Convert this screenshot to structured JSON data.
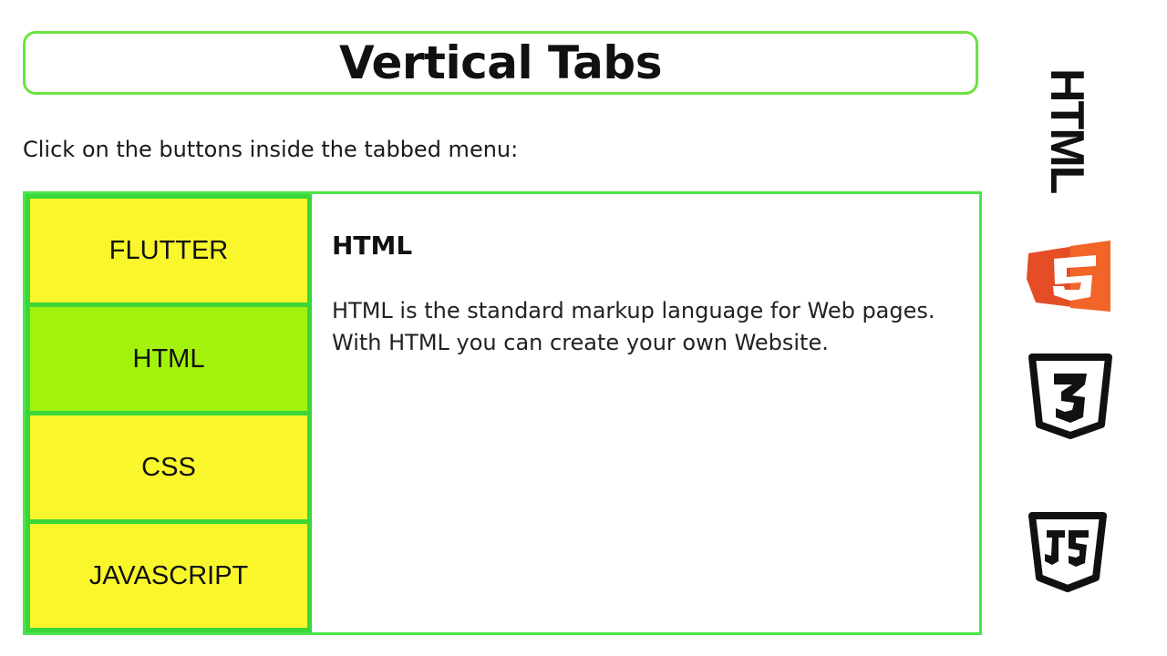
{
  "header": {
    "title": "Vertical Tabs"
  },
  "instruction": "Click on the buttons inside the tabbed menu:",
  "tabs": [
    {
      "label": "FLUTTER",
      "active": false
    },
    {
      "label": "HTML",
      "active": true
    },
    {
      "label": "CSS",
      "active": false
    },
    {
      "label": "JAVASCRIPT",
      "active": false
    }
  ],
  "content": {
    "heading": "HTML",
    "line1": "HTML is the standard markup language for Web pages.",
    "line2": "With HTML you can create your own Website."
  },
  "side_logos": {
    "html_word": "HTML",
    "html5_icon": "html5-shield-icon",
    "css3_icon": "css3-shield-icon",
    "js_icon": "js-shield-icon"
  },
  "colors": {
    "accent_green": "#4ae54a",
    "tab_bg": "#f9f72c",
    "tab_active_bg": "#a2f20d",
    "html5_orange": "#e44d26"
  }
}
